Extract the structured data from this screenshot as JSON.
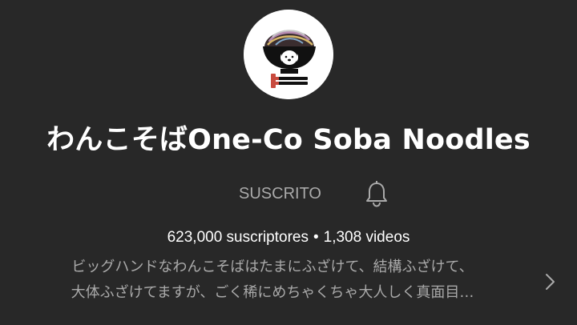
{
  "channel": {
    "name": "わんこそばOne-Co Soba Noodles",
    "avatar_icon": "noodle-bowl-avatar",
    "subscribe_label": "SUSCRITO",
    "bell_icon": "bell-icon",
    "subscribers": "623,000 suscriptores",
    "separator": "•",
    "videos": "1,308 videos",
    "description_lines": [
      "ビッグハンドなわんこそばはたまにふざけて、結構ふざけて、",
      "大体ふざけてますが、ごく稀にめちゃくちゃ大人しく真面目…"
    ],
    "expand_icon": "chevron-right-icon"
  },
  "colors": {
    "background": "#282828",
    "primary_text": "#ffffff",
    "secondary_text": "#aaaaaa"
  }
}
